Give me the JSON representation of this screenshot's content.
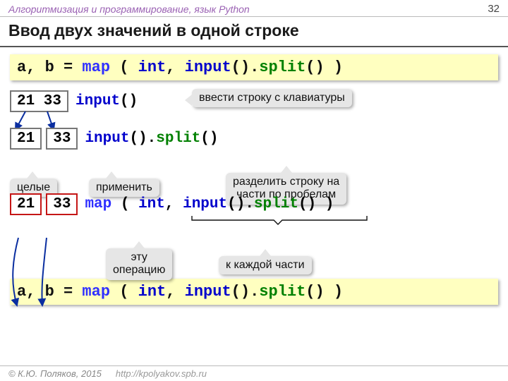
{
  "header": {
    "course": "Алгоритмизация и программирование, язык Python",
    "page": "32"
  },
  "title": "Ввод двух значений в одной строке",
  "codebar1": {
    "lhs": "a, b =",
    "map": "map",
    "p1": " ( ",
    "int": "int",
    "c1": ", ",
    "input": "input",
    "c2": "().",
    "split": "split",
    "tail": "() )"
  },
  "row1": {
    "box": "21 33",
    "code_input": "input",
    "suffix": "()",
    "callout": "ввести строку с клавиатуры"
  },
  "row2": {
    "box1": "21",
    "box2": "33",
    "code_input": "input",
    "mid": "().",
    "code_split": "split",
    "suffix": "()"
  },
  "callouts2": {
    "whole": "целые",
    "apply": "применить",
    "splitparts": "разделить строку на\nчасти по пробелам"
  },
  "row3": {
    "box1": "21",
    "box2": "33",
    "map": "map",
    "p1": " ( ",
    "int": "int",
    "c1": ", ",
    "input": "input",
    "c2": "().",
    "split": "split",
    "tail": "() )",
    "callout_op": "эту\nоперацию",
    "callout_each": "к каждой части"
  },
  "codebar2": {
    "lhs": "a, b =",
    "map": "map",
    "p1": " ( ",
    "int": "int",
    "c1": ", ",
    "input": "input",
    "c2": "().",
    "split": "split",
    "tail": "() )"
  },
  "footer": {
    "copyright": "© К.Ю. Поляков, 2015",
    "url": "http://kpolyakov.spb.ru"
  }
}
